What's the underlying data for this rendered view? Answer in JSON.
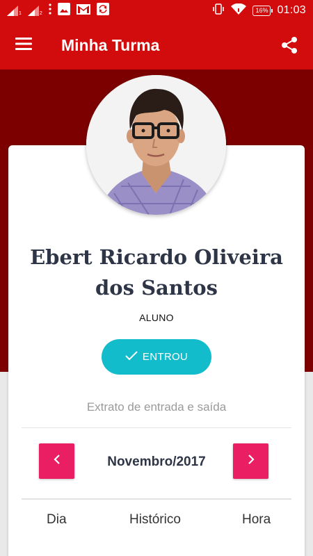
{
  "status_bar": {
    "sim1": "1",
    "sim2": "2",
    "battery": "16%",
    "time": "01:03",
    "icons": [
      "signal-icon",
      "more-vert-icon",
      "image-icon",
      "gmail-icon",
      "sync-icon",
      "vibrate-icon",
      "wifi-icon",
      "battery-icon"
    ]
  },
  "app_bar": {
    "title": "Minha Turma",
    "menu_icon": "menu-icon",
    "share_icon": "share-icon"
  },
  "colors": {
    "primary": "#d20c0c",
    "hero": "#7d0000",
    "accent": "#e91e63",
    "status_button": "#13bccb",
    "name_text": "#2d3546"
  },
  "profile": {
    "name": "Ebert Ricardo Oliveira dos Santos",
    "role": "ALUNO",
    "status_label": "ENTROU"
  },
  "history": {
    "title": "Extrato de entrada e saída",
    "month": "Novembro/2017",
    "columns": [
      "Dia",
      "Histórico",
      "Hora"
    ]
  }
}
